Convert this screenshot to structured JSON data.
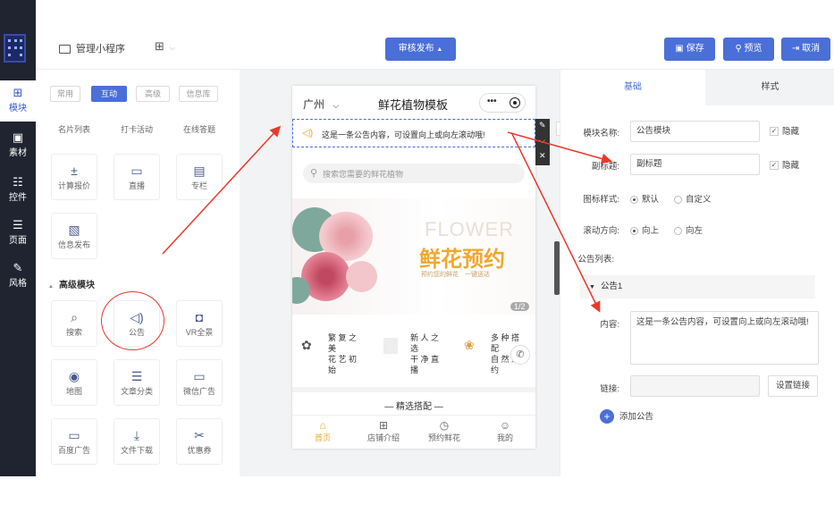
{
  "sidebar": {
    "items": [
      {
        "label": "模块",
        "icon": "plus-square-icon"
      },
      {
        "label": "素材",
        "icon": "film-icon"
      },
      {
        "label": "控件",
        "icon": "sliders-icon"
      },
      {
        "label": "页面",
        "icon": "layers-icon"
      },
      {
        "label": "风格",
        "icon": "brush-icon"
      }
    ]
  },
  "topbar": {
    "app_name": "管理小程序",
    "publish": "审核发布",
    "save": "保存",
    "preview": "预览",
    "cancel": "取消"
  },
  "widgets": {
    "tabs": [
      "常用",
      "互动",
      "高级",
      "信息库"
    ],
    "row0": [
      "名片列表",
      "打卡活动",
      "在线答题"
    ],
    "row1": [
      "计算报价",
      "直播",
      "专栏"
    ],
    "row2": [
      "信息发布"
    ],
    "advanced_title": "高级模块",
    "adv": [
      "搜索",
      "公告",
      "VR全景",
      "地图",
      "文章分类",
      "微信广告",
      "百度广告",
      "文件下载",
      "优惠券"
    ]
  },
  "phone": {
    "city": "广州",
    "title": "鲜花植物模板",
    "notice": "这是一条公告内容，可设置向上或向左滚动哦!",
    "search_placeholder": "搜索您需要的鲜花植物",
    "banner_en": "FLOWER",
    "banner_cn": "鲜花预约",
    "banner_sub1": "预约您的鲜花",
    "banner_sub2": "一键送达",
    "banner_page": "1/2",
    "feat1": [
      "繁 复 之",
      "美",
      "花 艺 初",
      "始"
    ],
    "feat2": [
      "新 人 之",
      "选",
      "干 净 直",
      "播"
    ],
    "feat3": [
      "多 种 搭",
      "配",
      "自 然 之",
      "约"
    ],
    "section": "精选搭配",
    "nav": [
      "首页",
      "店铺介绍",
      "预约鲜花",
      "我的"
    ],
    "edit_tip": "编辑"
  },
  "props": {
    "tabs": [
      "基础",
      "样式"
    ],
    "name_label": "模块名称:",
    "name_value": "公告模块",
    "hide": "隐藏",
    "subtitle_label": "副标题:",
    "subtitle_value": "副标题",
    "hide2": "隐藏",
    "icon_style_label": "图标样式:",
    "icon_style_opts": [
      "默认",
      "自定义"
    ],
    "scroll_label": "滚动方向:",
    "scroll_opts": [
      "向上",
      "向左"
    ],
    "list_label": "公告列表:",
    "item_title": "公告1",
    "content_label": "内容:",
    "content_value": "这是一条公告内容，可设置向上或向左滚动哦!",
    "link_label": "链接:",
    "set_link": "设置链接",
    "add": "添加公告"
  },
  "colors": {
    "accent": "#4a6fd8",
    "arrow": "#e8392c",
    "banner_text": "#f0a830",
    "sidebar": "#1f2430"
  }
}
